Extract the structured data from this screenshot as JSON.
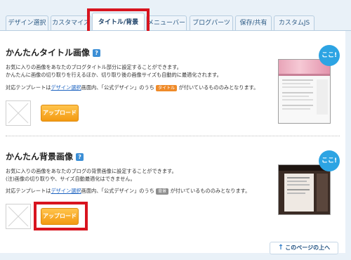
{
  "tabs": [
    {
      "label": "デザイン選択"
    },
    {
      "label": "カスタマイズ"
    },
    {
      "label": "タイトル/背景",
      "active": true
    },
    {
      "label": "メニューバー"
    },
    {
      "label": "ブログパーツ"
    },
    {
      "label": "保存/共有"
    },
    {
      "label": "カスタムJS"
    }
  ],
  "title_section": {
    "heading": "かんたんタイトル画像",
    "help_icon": "?",
    "line1": "お気に入りの画像をあなたのブログタイトル部分に設定することができます。",
    "line2": "かんたんに画像の切り取りを行えるほか、切り取り後の画像サイズも自動的に最適化されます。",
    "template_pre": "対応テンプレートは",
    "template_link": "デザイン選択",
    "template_mid": "画面内、「公式デザイン」のうち",
    "template_badge": "タイトル",
    "template_post": "が付いているもののみとなります。",
    "upload_label": "アップロード",
    "bubble": "ここ!"
  },
  "bg_section": {
    "heading": "かんたん背景画像",
    "help_icon": "?",
    "line1": "お気に入りの画像をあなたのブログの背景画像に設定することができます。",
    "line2": "(注)画像の切り取りや、サイズ自動最適化はできません。",
    "template_pre": "対応テンプレートは",
    "template_link": "デザイン選択",
    "template_mid": "画面内、「公式デザイン」のうち",
    "template_badge": "背景",
    "template_post": "が付いているもののみとなります。",
    "upload_label": "アップロード",
    "bubble": "ここ!"
  },
  "page_top": {
    "arrow": "↑",
    "label": "このページの上へ"
  },
  "colors": {
    "highlight": "#d8141f",
    "upload_button": "#f39a12",
    "bubble": "#2da4e3",
    "link": "#1b62c0",
    "tab_text": "#2d5b85"
  },
  "icons": [
    "help-icon",
    "image-placeholder-icon",
    "arrow-up-icon"
  ]
}
